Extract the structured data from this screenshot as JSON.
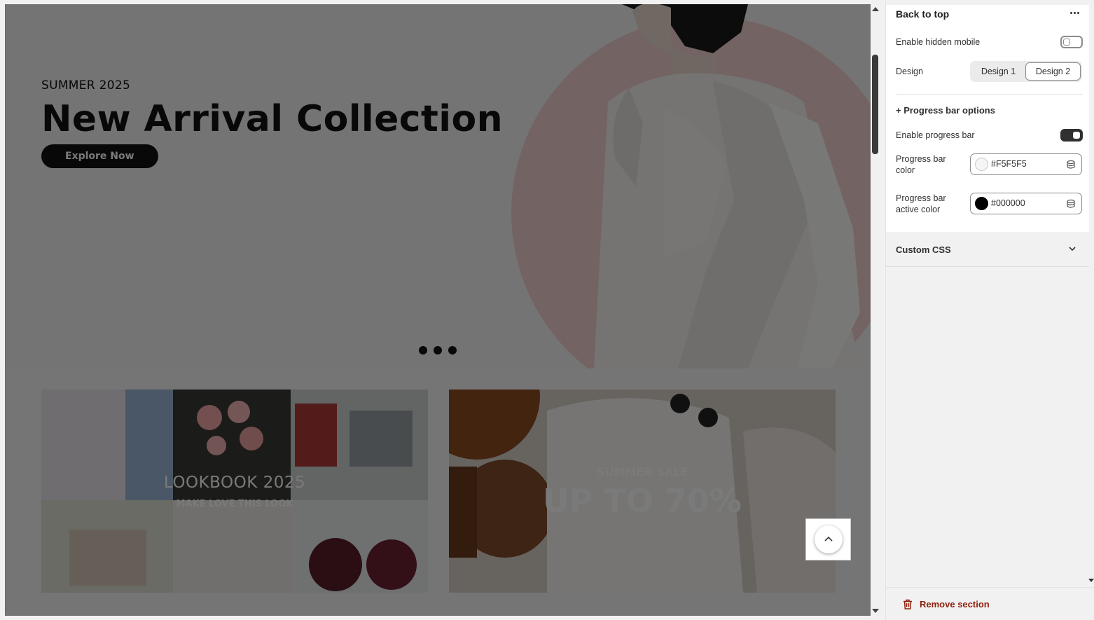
{
  "hero": {
    "eyebrow": "SUMMER 2025",
    "title": "New Arrival Collection",
    "button_label": "Explore Now",
    "slide_count": 3
  },
  "banners": {
    "left": {
      "title": "LOOKBOOK 2025",
      "subtitle": "MAKE LOVE THIS LOOK"
    },
    "right": {
      "subtitle": "SUMMER SALE",
      "title": "UP TO 70%"
    }
  },
  "panel": {
    "section_title": "Back to top",
    "enable_hidden_mobile": {
      "label": "Enable hidden mobile",
      "checked": false
    },
    "design": {
      "label": "Design",
      "options": [
        "Design 1",
        "Design 2"
      ],
      "selected": "Design 2"
    },
    "progress_options_label": "+ Progress bar options",
    "enable_progress_bar": {
      "label": "Enable progress bar",
      "checked": true
    },
    "progress_bar_color": {
      "label_line1": "Progress bar",
      "label_line2": "color",
      "value": "#F5F5F5"
    },
    "progress_bar_active_color": {
      "label_line1": "Progress bar",
      "label_line2": "active color",
      "value": "#000000"
    },
    "custom_css_label": "Custom CSS",
    "remove_label": "Remove section"
  },
  "colors": {
    "overlay": "rgba(0,0,0,0.52)",
    "remove": "#8e1f0b",
    "hero_circle": "#f2cfcf"
  }
}
